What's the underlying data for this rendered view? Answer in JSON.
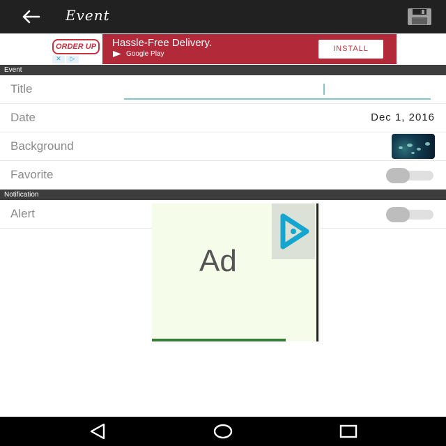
{
  "toolbar": {
    "title": "Event",
    "back_icon": "arrow-left-icon",
    "save_icon": "floppy-disk-icon",
    "background_color": "#212121"
  },
  "top_ad": {
    "brand": "ORDER UP",
    "headline": "Hassle-Free Delivery.",
    "store": "Google Play",
    "install_label": "INSTALL",
    "background_color": "#b2293a"
  },
  "event_section": {
    "header": "Event",
    "title_row": {
      "label": "Title",
      "value": ""
    },
    "date_row": {
      "label": "Date",
      "value": "Dec 1, 2016"
    },
    "background_row": {
      "label": "Background"
    },
    "favorite_row": {
      "label": "Favorite",
      "enabled": false
    }
  },
  "notification_section": {
    "header": "Notification",
    "alert_row": {
      "label": "Alert",
      "enabled": false
    }
  },
  "square_ad": {
    "text": "Ad",
    "badge_icon": "ad-choices-icon"
  },
  "accent_color": "#7fc8cc",
  "nav_bar": {
    "back_icon": "triangle-back-icon",
    "home_icon": "circle-home-icon",
    "recents_icon": "square-recents-icon"
  }
}
